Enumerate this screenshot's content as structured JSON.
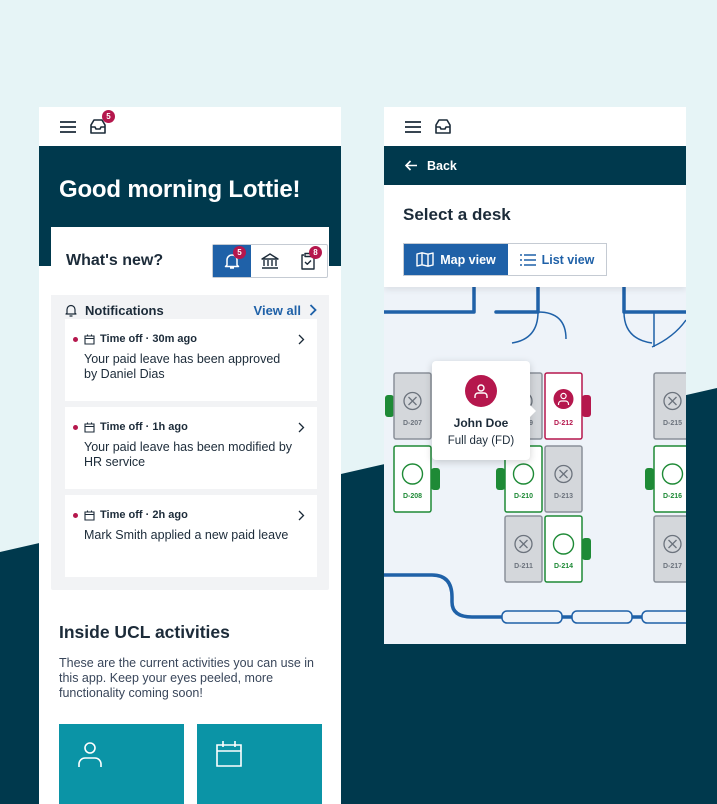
{
  "left": {
    "inbox_badge": "5",
    "greeting": "Good morning Lottie!",
    "whats_new": "What's new?",
    "tabs": [
      {
        "icon": "bell-icon",
        "badge": "5",
        "active": true
      },
      {
        "icon": "bank-icon",
        "badge": "",
        "active": false
      },
      {
        "icon": "clipboard-check-icon",
        "badge": "8",
        "active": false
      }
    ],
    "notifications_label": "Notifications",
    "view_all": "View all",
    "items": [
      {
        "meta": "Time off · 30m ago",
        "msg": "Your paid leave has been approved by Daniel Dias"
      },
      {
        "meta": "Time off · 1h ago",
        "msg": "Your paid leave has been modified by HR service"
      },
      {
        "meta": "Time off · 2h ago",
        "msg": "Mark Smith applied a new paid leave"
      }
    ],
    "ucl_title": "Inside UCL activities",
    "ucl_desc": "These are the current activities you can use in this app. Keep your eyes peeled, more functionality coming soon!"
  },
  "right": {
    "back": "Back",
    "title": "Select a desk",
    "map_view": "Map view",
    "list_view": "List view",
    "tooltip_name": "John Doe",
    "tooltip_status": "Full day (FD)",
    "desks": [
      {
        "id": "D-207",
        "state": "unavailable"
      },
      {
        "id": "D-208",
        "state": "available"
      },
      {
        "id": "D-209",
        "state": "unavailable"
      },
      {
        "id": "D-210",
        "state": "available"
      },
      {
        "id": "D-211",
        "state": "unavailable"
      },
      {
        "id": "D-212",
        "state": "booked"
      },
      {
        "id": "D-213",
        "state": "unavailable"
      },
      {
        "id": "D-214",
        "state": "available"
      },
      {
        "id": "D-215",
        "state": "unavailable"
      },
      {
        "id": "D-216",
        "state": "available"
      },
      {
        "id": "D-217",
        "state": "unavailable"
      }
    ]
  },
  "colors": {
    "navy": "#00394d",
    "primary_blue": "#1f61a8",
    "badge_red": "#b5174d",
    "available_green": "#1e8a36",
    "unavailable_grey": "#d4d7db",
    "teal_tile": "#0b94a6",
    "map_wall_blue": "#1f61a8"
  }
}
